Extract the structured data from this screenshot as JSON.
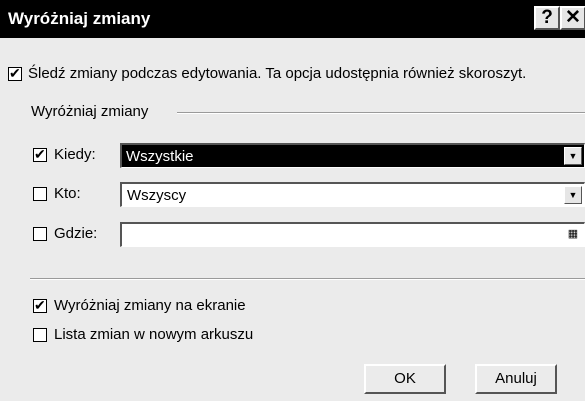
{
  "window": {
    "title": "Wyróżniaj zmiany",
    "help_glyph": "?",
    "close_glyph": "✕"
  },
  "track_changes": {
    "checked": true,
    "label": "Śledź zmiany podczas edytowania. Ta opcja udostępnia również skoroszyt."
  },
  "highlight_group": {
    "label": "Wyróżniaj zmiany",
    "when": {
      "checked": true,
      "label": "Kiedy:",
      "value": "Wszystkie"
    },
    "who": {
      "checked": false,
      "label": "Kto:",
      "value": "Wszyscy"
    },
    "where": {
      "checked": false,
      "label": "Gdzie:",
      "value": ""
    }
  },
  "options": {
    "on_screen": {
      "checked": true,
      "label": "Wyróżniaj zmiany na ekranie"
    },
    "new_sheet": {
      "checked": false,
      "label": "Lista zmian w nowym arkuszu"
    }
  },
  "buttons": {
    "ok": "OK",
    "cancel": "Anuluj"
  }
}
